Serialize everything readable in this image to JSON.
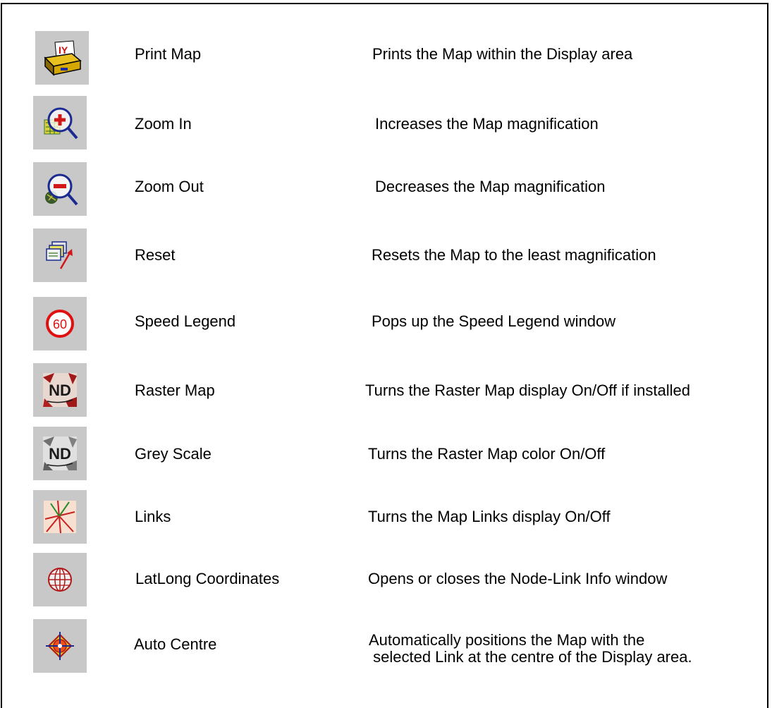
{
  "items": [
    {
      "icon": "print-map-icon",
      "name": "Print Map",
      "description": "Prints the Map within the Display area"
    },
    {
      "icon": "zoom-in-icon",
      "name": "Zoom In",
      "description": "Increases the Map magnification"
    },
    {
      "icon": "zoom-out-icon",
      "name": "Zoom Out",
      "description": "Decreases the Map magnification"
    },
    {
      "icon": "reset-icon",
      "name": "Reset",
      "description": "Resets the Map to the least magnification"
    },
    {
      "icon": "speed-legend-icon",
      "name": "Speed Legend",
      "description": "Pops up the Speed Legend window"
    },
    {
      "icon": "raster-map-icon",
      "name": "Raster Map",
      "description": "Turns the Raster Map display On/Off if installed"
    },
    {
      "icon": "grey-scale-icon",
      "name": "Grey Scale",
      "description": "Turns the Raster Map color On/Off"
    },
    {
      "icon": "links-icon",
      "name": "Links",
      "description": "Turns the Map Links display On/Off"
    },
    {
      "icon": "latlong-coordinates-icon",
      "name": "LatLong Coordinates",
      "description": "Opens or closes the Node-Link Info window"
    },
    {
      "icon": "auto-centre-icon",
      "name": "Auto Centre",
      "description": "Automatically positions the Map with the\n selected Link at the centre of the Display area."
    }
  ],
  "icon_speed_limit_text": "60",
  "icon_nd_text": "ND"
}
